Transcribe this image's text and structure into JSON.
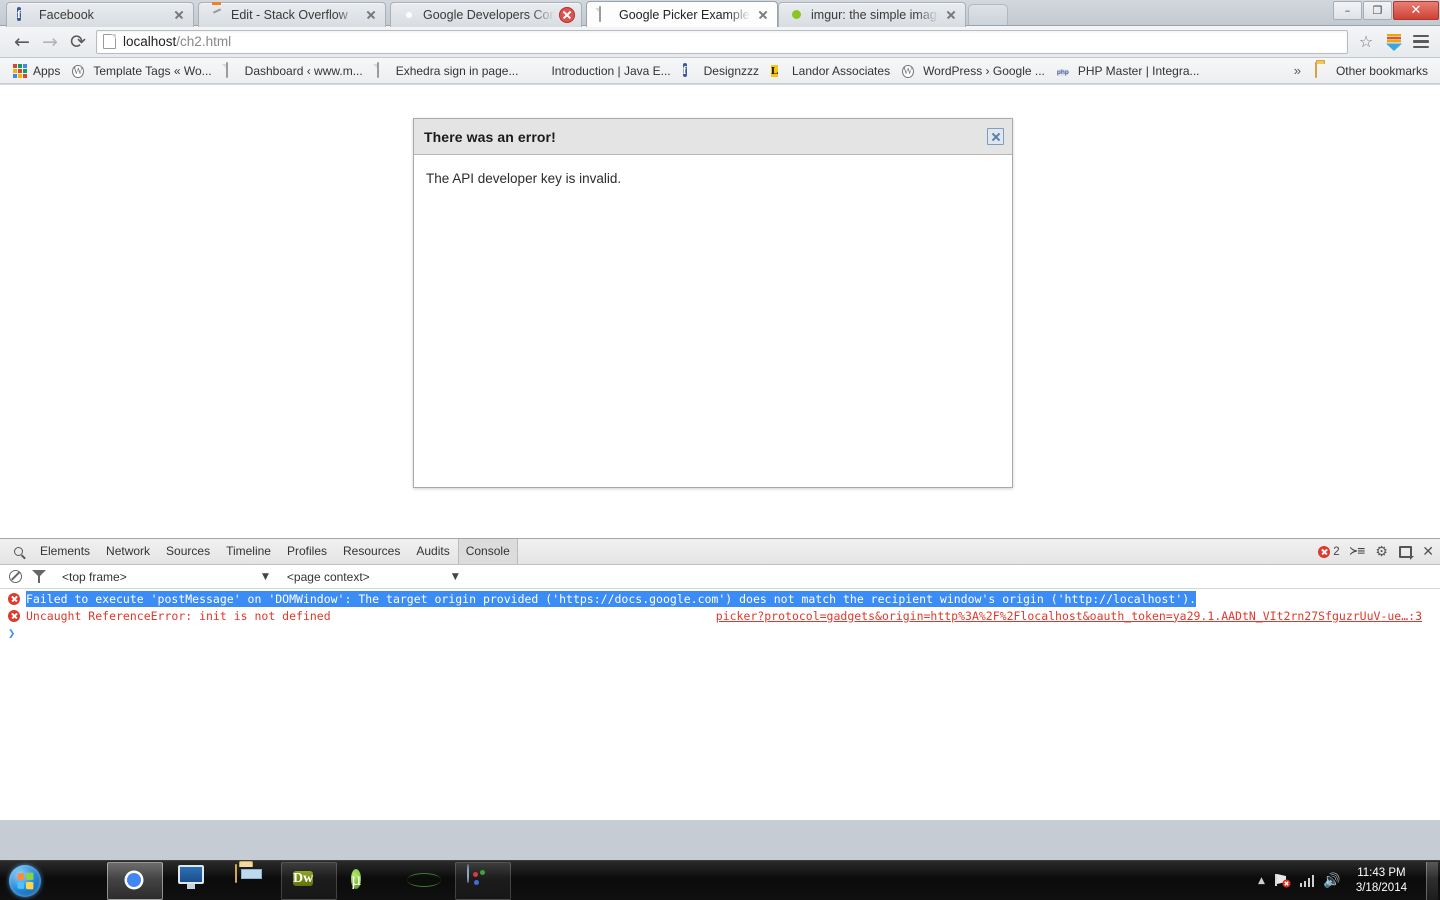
{
  "window": {
    "minimize_label": "–",
    "restore_label": "❐",
    "close_label": "✕"
  },
  "tabs": [
    {
      "title": "Facebook",
      "favicon": "facebook-icon",
      "active": false,
      "close_style": "plain"
    },
    {
      "title": "Edit - Stack Overflow",
      "favicon": "stackoverflow-icon",
      "active": false,
      "close_style": "plain"
    },
    {
      "title": "Google Developers Conso",
      "favicon": "google-icon",
      "active": false,
      "close_style": "red"
    },
    {
      "title": "Google Picker Example",
      "favicon": "document-icon",
      "active": true,
      "close_style": "plain"
    },
    {
      "title": "imgur: the simple image s",
      "favicon": "imgur-icon",
      "active": false,
      "close_style": "plain"
    }
  ],
  "toolbar": {
    "back_label": "←",
    "forward_label": "→",
    "reload_label": "⟳",
    "url_host": "localhost",
    "url_path": "/ch2.html",
    "star_label": "☆",
    "icons": [
      "page-icon",
      "star-icon",
      "extension-icon",
      "chrome-menu-icon"
    ]
  },
  "bookmarks": {
    "apps_label": "Apps",
    "items": [
      {
        "label": "Template Tags « Wo...",
        "icon": "wordpress-icon"
      },
      {
        "label": "Dashboard ‹ www.m...",
        "icon": "document-icon"
      },
      {
        "label": "Exhedra sign in page...",
        "icon": "document-icon"
      },
      {
        "label": "Introduction | Java E...",
        "icon": "java-icon"
      },
      {
        "label": "Designzzz",
        "icon": "facebook-icon"
      },
      {
        "label": "Landor Associates",
        "icon": "landor-icon"
      },
      {
        "label": "WordPress › Google ...",
        "icon": "wordpress-icon"
      },
      {
        "label": "PHP Master | Integra...",
        "icon": "php-icon"
      }
    ],
    "overflow_label": "»",
    "other_bookmarks_label": "Other bookmarks"
  },
  "dialog": {
    "title": "There was an error!",
    "body": "The API developer key is invalid.",
    "close_icon": "close-icon"
  },
  "devtools": {
    "tabs": [
      "Elements",
      "Network",
      "Sources",
      "Timeline",
      "Profiles",
      "Resources",
      "Audits",
      "Console"
    ],
    "active_tab": "Console",
    "error_count": "2",
    "search_icon": "search-icon",
    "right_icons": [
      "error-count-badge",
      "console-drawer-icon",
      "settings-gear-icon",
      "dock-position-icon",
      "close-icon"
    ],
    "filter_bar": {
      "clear_icon": "clear-console-icon",
      "filter_icon": "filter-icon",
      "frame_selector": "<top frame>",
      "context_selector": "<page context>",
      "caret": "▼"
    },
    "messages": [
      {
        "level": "error",
        "selected": true,
        "text": "Failed to execute 'postMessage' on 'DOMWindow': The target origin provided ('https://docs.google.com') does not match the recipient window's origin ('http://localhost').",
        "source": ""
      },
      {
        "level": "error",
        "selected": false,
        "text": "Uncaught ReferenceError: init is not defined",
        "source": "picker?protocol=gadgets&origin=http%3A%2F%2Flocalhost&oauth_token=ya29.1.AADtN_VIt2rn27SfguzrUuV-ue…:3"
      }
    ],
    "prompt_symbol": "❯"
  },
  "taskbar": {
    "start_label": "Start",
    "buttons": [
      {
        "name": "firefox",
        "state": "idle"
      },
      {
        "name": "chrome",
        "state": "active"
      },
      {
        "name": "computer",
        "state": "idle"
      },
      {
        "name": "file-explorer",
        "state": "idle"
      },
      {
        "name": "dreamweaver",
        "state": "open"
      },
      {
        "name": "utorrent",
        "state": "idle"
      },
      {
        "name": "globe-browser",
        "state": "idle"
      },
      {
        "name": "paint",
        "state": "open"
      }
    ],
    "tray": {
      "arrow_label": "▲",
      "network_icon": "network-error-icon",
      "signal_icon": "signal-bars-icon",
      "volume_icon": "🔊",
      "time": "11:43 PM",
      "date": "3/18/2014"
    }
  },
  "colors": {
    "error_red": "#e0392b",
    "selection_blue": "#3b8cf5",
    "dialog_header": "#e4e4e4"
  }
}
